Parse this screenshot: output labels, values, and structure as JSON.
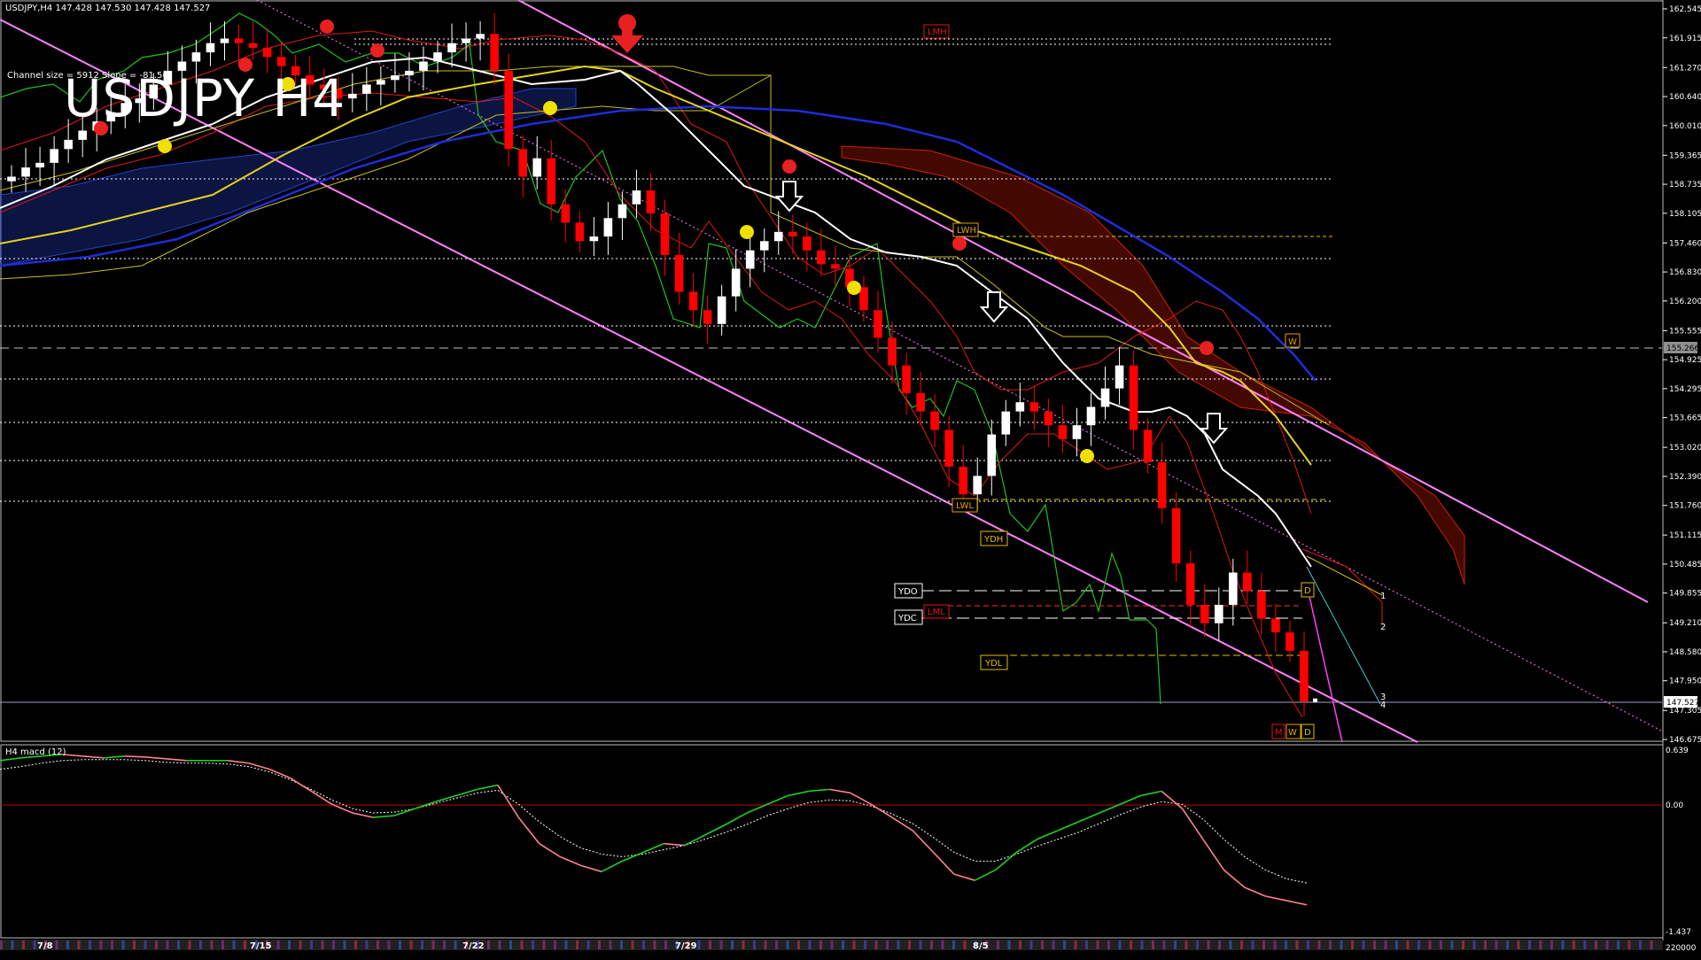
{
  "header": {
    "symbol_info": "USDJPY,H4  147.428 147.530 147.428 147.527",
    "big_title": "USDJPY H4",
    "channel_info": "Channel size = 5912 Slope = -81.56",
    "macd_label": "H4  macd (12)"
  },
  "price_axis": {
    "ticks": [
      "162.545",
      "161.915",
      "161.270",
      "160.640",
      "160.010",
      "159.365",
      "158.735",
      "158.105",
      "157.460",
      "156.830",
      "156.200",
      "155.555",
      "154.925",
      "154.295",
      "153.665",
      "153.020",
      "152.390",
      "151.760",
      "151.115",
      "150.485",
      "149.855",
      "149.210",
      "148.580",
      "147.950",
      "147.305",
      "146.675"
    ],
    "current_price": "147.527",
    "level_155": "155.266"
  },
  "macd_axis": {
    "top": "0.639",
    "zero": "0.00",
    "bottom": "-1.437",
    "volume": "220000"
  },
  "time_axis": {
    "labels": [
      "7/8",
      "7/15",
      "7/22",
      "7/29",
      "8/5"
    ]
  },
  "levels": {
    "LMH": "LMH",
    "LWH": "LWH",
    "LWL": "LWL",
    "YDH": "YDH",
    "YDO": "YDO",
    "YDC": "YDC",
    "LML": "LML",
    "YDL": "YDL",
    "W": "W",
    "D": "D",
    "M": "M",
    "n1": "1",
    "n2": "2",
    "n3": "3",
    "n4": "4"
  },
  "colors": {
    "background": "#000000",
    "bull": "#ffffff",
    "bear": "#ff0000",
    "ma_white": "#ffffff",
    "ma_yellow": "#e6d21e",
    "ma_blue": "#1e2ddc",
    "channel": "#ff80ff",
    "kumo": "#cc2200",
    "lagging": "#20c020",
    "macd_up": "#20d020",
    "macd_down": "#ff8090",
    "signal": "#ffffff"
  },
  "chart_data": [
    {
      "type": "candlestick",
      "title": "USDJPY H4",
      "xlabel": "",
      "ylabel": "",
      "ylim": [
        146.675,
        162.545
      ],
      "x_ticks": [
        "7/8",
        "7/15",
        "7/22",
        "7/29",
        "8/5"
      ],
      "y_ticks": [
        162.545,
        161.915,
        161.27,
        160.64,
        160.01,
        159.365,
        158.735,
        158.105,
        157.46,
        156.83,
        156.2,
        155.555,
        154.925,
        154.295,
        153.665,
        153.02,
        152.39,
        151.76,
        151.115,
        150.485,
        149.855,
        149.21,
        148.58,
        147.95,
        147.305,
        146.675
      ],
      "close_series": [
        158.9,
        159.1,
        159.2,
        159.5,
        159.7,
        159.9,
        160.1,
        160.3,
        160.5,
        160.6,
        160.9,
        161.2,
        161.4,
        161.6,
        161.8,
        161.9,
        161.8,
        161.7,
        161.5,
        161.3,
        161.1,
        160.9,
        160.8,
        160.6,
        160.7,
        160.9,
        161.0,
        161.1,
        161.2,
        161.4,
        161.6,
        161.8,
        161.9,
        162.0,
        161.2,
        159.5,
        158.9,
        159.3,
        158.3,
        157.9,
        157.5,
        157.6,
        158.0,
        158.3,
        158.6,
        158.1,
        157.2,
        156.4,
        156.0,
        155.7,
        156.3,
        156.9,
        157.3,
        157.5,
        157.7,
        157.6,
        157.3,
        157.0,
        156.9,
        156.5,
        156.0,
        155.4,
        154.8,
        154.2,
        153.8,
        153.4,
        152.6,
        152.0,
        152.4,
        153.3,
        153.8,
        154.0,
        153.8,
        153.5,
        153.2,
        153.5,
        153.9,
        154.3,
        154.8,
        153.4,
        152.7,
        151.7,
        150.5,
        149.6,
        149.2,
        149.6,
        150.3,
        149.9,
        149.3,
        149.0,
        148.6,
        147.5
      ],
      "current_price": 147.527
    },
    {
      "type": "line",
      "title": "H4 macd (12)",
      "ylim": [
        -1.437,
        0.639
      ],
      "series": [
        {
          "values": [
            0.55,
            0.58,
            0.6,
            0.62,
            0.6,
            0.58,
            0.6,
            0.59,
            0.57,
            0.55,
            0.55,
            0.55,
            0.52,
            0.45,
            0.35,
            0.2,
            0.05,
            -0.05,
            -0.1,
            -0.08,
            0.0,
            0.08,
            0.15,
            0.22,
            0.27,
            -0.1,
            -0.4,
            -0.55,
            -0.65,
            -0.72,
            -0.6,
            -0.5,
            -0.4,
            -0.42,
            -0.3,
            -0.18,
            -0.05,
            0.05,
            0.15,
            0.2,
            0.22,
            0.18,
            0.05,
            -0.1,
            -0.25,
            -0.5,
            -0.75,
            -0.82,
            -0.7,
            -0.5,
            -0.35,
            -0.25,
            -0.15,
            -0.05,
            0.05,
            0.15,
            0.2,
            0.0,
            -0.35,
            -0.7,
            -0.9,
            -1.0,
            -1.05,
            -1.1
          ]
        },
        {
          "values": [
            0.45,
            0.48,
            0.52,
            0.55,
            0.56,
            0.56,
            0.56,
            0.55,
            0.53,
            0.52,
            0.52,
            0.51,
            0.48,
            0.42,
            0.33,
            0.22,
            0.1,
            0.0,
            -0.05,
            -0.04,
            0.0,
            0.06,
            0.12,
            0.18,
            0.21,
            0.05,
            -0.15,
            -0.32,
            -0.45,
            -0.52,
            -0.55,
            -0.52,
            -0.47,
            -0.42,
            -0.35,
            -0.27,
            -0.18,
            -0.08,
            0.0,
            0.07,
            0.1,
            0.09,
            0.03,
            -0.06,
            -0.17,
            -0.33,
            -0.5,
            -0.6,
            -0.6,
            -0.52,
            -0.43,
            -0.35,
            -0.27,
            -0.17,
            -0.07,
            0.02,
            0.08,
            0.05,
            -0.12,
            -0.35,
            -0.55,
            -0.7,
            -0.8,
            -0.85
          ]
        }
      ]
    }
  ]
}
